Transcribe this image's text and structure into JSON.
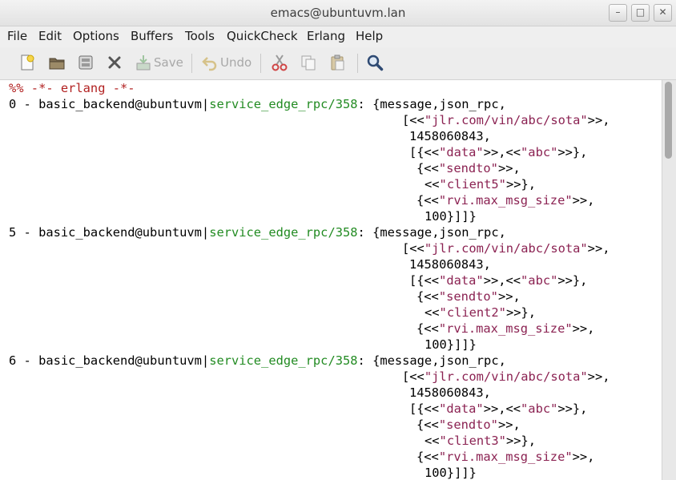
{
  "window": {
    "title": "emacs@ubuntuvm.lan",
    "min_glyph": "–",
    "max_glyph": "□",
    "close_glyph": "✕"
  },
  "menu": [
    "File",
    "Edit",
    "Options",
    "Buffers",
    "Tools",
    "QuickCheck",
    "Erlang",
    "Help"
  ],
  "toolbar": {
    "save_label": "Save",
    "undo_label": "Undo",
    "icons": [
      "new-file-icon",
      "open-folder-icon",
      "dired-icon",
      "close-buffer-icon",
      "save-icon",
      "undo-icon",
      "cut-icon",
      "copy-icon",
      "paste-icon",
      "search-icon"
    ]
  },
  "buffer": {
    "mode_line": "%% -*- erlang -*-",
    "entries": [
      {
        "prefix": "0 - basic_backend@ubuntuvm|",
        "func": "service_edge_rpc/358",
        "colon": ": ",
        "head": "{message,json_rpc,",
        "url": "\"jlr.com/vin/abc/sota\"",
        "number": "1458060843,",
        "data_key": "\"data\"",
        "data_val": "\"abc\"",
        "sendto_key": "\"sendto\"",
        "client": "\"client5\"",
        "max_key": "\"rvi.max_msg_size\"",
        "max_val": "100}]]}"
      },
      {
        "prefix": "5 - basic_backend@ubuntuvm|",
        "func": "service_edge_rpc/358",
        "colon": ": ",
        "head": "{message,json_rpc,",
        "url": "\"jlr.com/vin/abc/sota\"",
        "number": "1458060843,",
        "data_key": "\"data\"",
        "data_val": "\"abc\"",
        "sendto_key": "\"sendto\"",
        "client": "\"client2\"",
        "max_key": "\"rvi.max_msg_size\"",
        "max_val": "100}]]}"
      },
      {
        "prefix": "6 - basic_backend@ubuntuvm|",
        "func": "service_edge_rpc/358",
        "colon": ": ",
        "head": "{message,json_rpc,",
        "url": "\"jlr.com/vin/abc/sota\"",
        "number": "1458060843,",
        "data_key": "\"data\"",
        "data_val": "\"abc\"",
        "sendto_key": "\"sendto\"",
        "client": "\"client3\"",
        "max_key": "\"rvi.max_msg_size\"",
        "max_val": "100}]]}"
      }
    ]
  }
}
